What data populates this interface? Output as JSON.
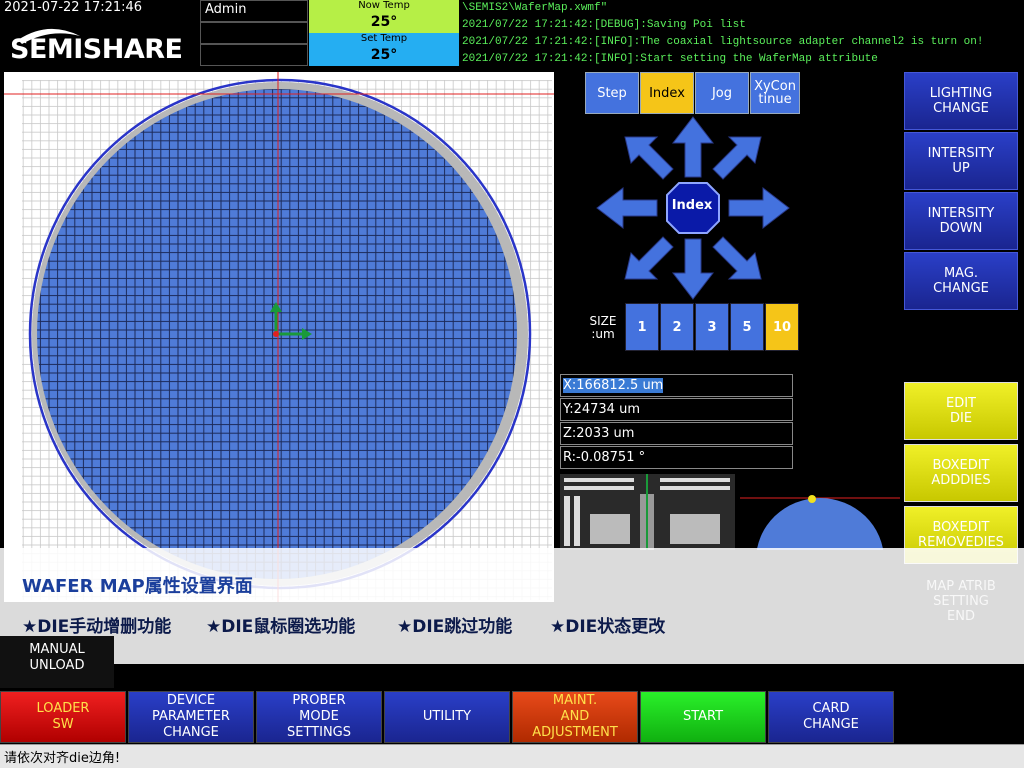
{
  "header": {
    "datetime": "2021-07-22 17:21:46",
    "logo": "SEMISHARE",
    "user": "Admin",
    "now_temp_label": "Now Temp",
    "now_temp_value": "25°",
    "set_temp_label": "Set Temp",
    "set_temp_value": "25°",
    "log": [
      "\\SEMIS2\\WaferMap.xwmf\"",
      "2021/07/22 17:21:42:[DEBUG]:Saving Poi list",
      "2021/07/22 17:21:42:[INFO]:The coaxial lightsource adapter channel2 is turn on!",
      "2021/07/22 17:21:42:[INFO]:Start setting the WaferMap attribute"
    ]
  },
  "mode_tabs": [
    {
      "label": "Step",
      "active": false
    },
    {
      "label": "Index",
      "active": true
    },
    {
      "label": "Jog",
      "active": false
    },
    {
      "label": "XyContinue",
      "active": false
    }
  ],
  "joystick": {
    "center_label": "Index"
  },
  "size": {
    "label": "SIZE\n:um",
    "options": [
      "1",
      "2",
      "3",
      "5",
      "10"
    ],
    "selected": "10"
  },
  "coords": {
    "x": "X:166812.5 um",
    "y": "Y:24734 um",
    "z": "Z:2033 um",
    "r": "R:-0.08751 °"
  },
  "right_buttons": {
    "lighting": "LIGHTING\nCHANGE",
    "int_up": "INTERSITY\nUP",
    "int_down": "INTERSITY\nDOWN",
    "mag": "MAG.\nCHANGE",
    "edit_die": "EDIT\nDIE",
    "boxedit_add": "BOXEDIT\nADDDIES",
    "boxedit_remove": "BOXEDIT\nREMOVEDIES",
    "map_atrib_end": "MAP ATRIB\nSETTING\nEND"
  },
  "overlay": {
    "title": "WAFER MAP属性设置界面",
    "features": [
      "★DIE手动增删功能",
      "★DIE鼠标圈选功能",
      "★DIE跳过功能",
      "★DIE状态更改"
    ]
  },
  "manual_unload": "MANUAL\nUNLOAD",
  "bottom": {
    "loader": "LOADER\nSW",
    "device": "DEVICE\nPARAMETER\nCHANGE",
    "prober": "PROBER\nMODE\nSETTINGS",
    "utility": "UTILITY",
    "maint": "MAINT.\nAND\nADJUSTMENT",
    "start": "START",
    "card": "CARD\nCHANGE"
  },
  "status_text": "请依次对齐die边角!",
  "colors": {
    "die_fill": "#4f7bd8",
    "die_edge_gray": "#b8b8b8",
    "accent_yellow": "#f5c518",
    "button_blue": "#2a3fc8",
    "log_green": "#5bf05b"
  }
}
